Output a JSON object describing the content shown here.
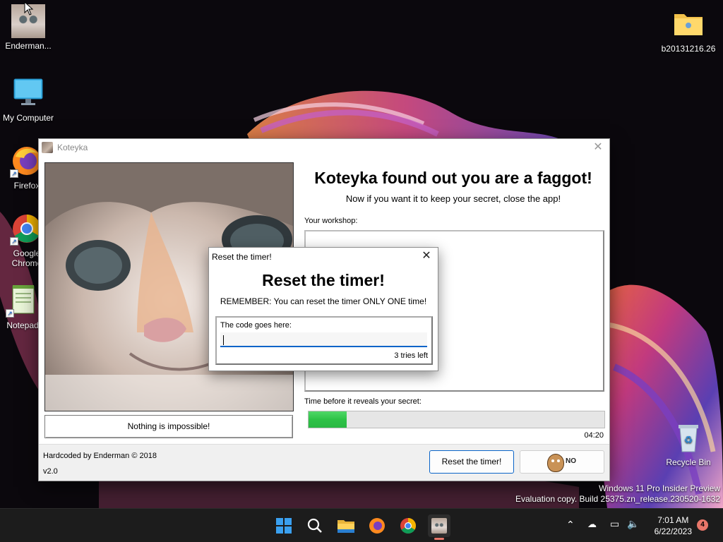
{
  "desktop": {
    "icons": [
      {
        "label": "Enderman..."
      },
      {
        "label": "My Computer"
      },
      {
        "label": "Firefox"
      },
      {
        "label": "Google Chrome"
      },
      {
        "label": "Notepad"
      },
      {
        "label": "b20131216.26"
      },
      {
        "label": "Recycle Bin"
      }
    ],
    "watermark_line1": "Windows 11 Pro Insider Preview",
    "watermark_line2": "Evaluation copy. Build 25375.zn_release.230520-1632"
  },
  "window": {
    "title": "Koteyka",
    "headline": "Koteyka found out you are a faggot!",
    "subline": "Now if you want it to keep your secret, close the app!",
    "workshop_label": "Your workshop:",
    "impossible_button": "Nothing is impossible!",
    "timer_label": "Time before it reveals your secret:",
    "timer_progress": 0.13,
    "time_left": "04:20",
    "credit": "Hardcoded by Enderman © 2018",
    "version": "v2.0",
    "reset_button": "Reset the timer!",
    "no_button_text": "NO"
  },
  "dialog": {
    "title": "Reset the timer!",
    "heading": "Reset the timer!",
    "remember": "REMEMBER: You can reset the timer ONLY ONE time!",
    "code_label": "The code goes here:",
    "code_value": "",
    "tries_left": "3 tries left"
  },
  "taskbar": {
    "clock_time": "7:01 AM",
    "clock_date": "6/22/2023",
    "notification_count": "4"
  },
  "colors": {
    "progress_fill": "#2ec247",
    "accent": "#0a64c8",
    "notif_badge": "#e8776a"
  }
}
